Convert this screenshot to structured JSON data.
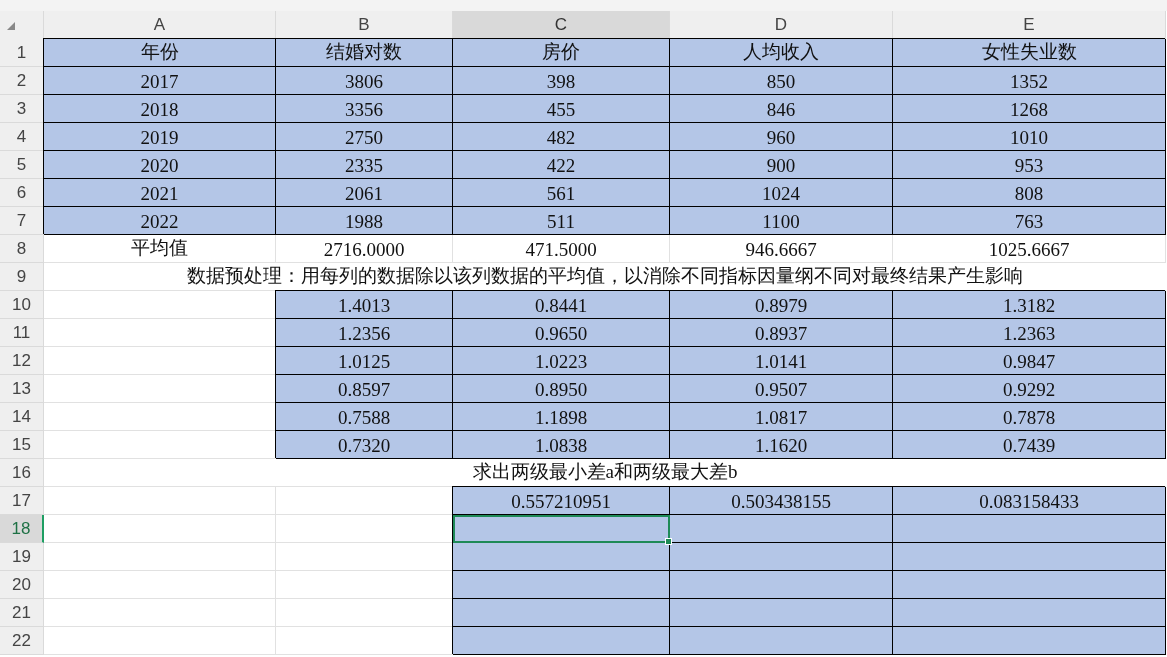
{
  "columns": [
    {
      "label": "A",
      "selected": false
    },
    {
      "label": "B",
      "selected": false
    },
    {
      "label": "C",
      "selected": true
    },
    {
      "label": "D",
      "selected": false
    },
    {
      "label": "E",
      "selected": false
    }
  ],
  "rows": [
    {
      "number": "1",
      "selected": false,
      "kind": "cells",
      "cells": [
        {
          "text": "年份",
          "filled": true,
          "selected": false
        },
        {
          "text": "结婚对数",
          "filled": true,
          "selected": false
        },
        {
          "text": "房价",
          "filled": true,
          "selected": false
        },
        {
          "text": "人均收入",
          "filled": true,
          "selected": false
        },
        {
          "text": "女性失业数",
          "filled": true,
          "selected": false
        }
      ]
    },
    {
      "number": "2",
      "selected": false,
      "kind": "cells",
      "cells": [
        {
          "text": "2017",
          "filled": true,
          "selected": false
        },
        {
          "text": "3806",
          "filled": true,
          "selected": false
        },
        {
          "text": "398",
          "filled": true,
          "selected": false
        },
        {
          "text": "850",
          "filled": true,
          "selected": false
        },
        {
          "text": "1352",
          "filled": true,
          "selected": false
        }
      ]
    },
    {
      "number": "3",
      "selected": false,
      "kind": "cells",
      "cells": [
        {
          "text": "2018",
          "filled": true,
          "selected": false
        },
        {
          "text": "3356",
          "filled": true,
          "selected": false
        },
        {
          "text": "455",
          "filled": true,
          "selected": false
        },
        {
          "text": "846",
          "filled": true,
          "selected": false
        },
        {
          "text": "1268",
          "filled": true,
          "selected": false
        }
      ]
    },
    {
      "number": "4",
      "selected": false,
      "kind": "cells",
      "cells": [
        {
          "text": "2019",
          "filled": true,
          "selected": false
        },
        {
          "text": "2750",
          "filled": true,
          "selected": false
        },
        {
          "text": "482",
          "filled": true,
          "selected": false
        },
        {
          "text": "960",
          "filled": true,
          "selected": false
        },
        {
          "text": "1010",
          "filled": true,
          "selected": false
        }
      ]
    },
    {
      "number": "5",
      "selected": false,
      "kind": "cells",
      "cells": [
        {
          "text": "2020",
          "filled": true,
          "selected": false
        },
        {
          "text": "2335",
          "filled": true,
          "selected": false
        },
        {
          "text": "422",
          "filled": true,
          "selected": false
        },
        {
          "text": "900",
          "filled": true,
          "selected": false
        },
        {
          "text": "953",
          "filled": true,
          "selected": false
        }
      ]
    },
    {
      "number": "6",
      "selected": false,
      "kind": "cells",
      "cells": [
        {
          "text": "2021",
          "filled": true,
          "selected": false
        },
        {
          "text": "2061",
          "filled": true,
          "selected": false
        },
        {
          "text": "561",
          "filled": true,
          "selected": false
        },
        {
          "text": "1024",
          "filled": true,
          "selected": false
        },
        {
          "text": "808",
          "filled": true,
          "selected": false
        }
      ]
    },
    {
      "number": "7",
      "selected": false,
      "kind": "cells",
      "cells": [
        {
          "text": "2022",
          "filled": true,
          "selected": false
        },
        {
          "text": "1988",
          "filled": true,
          "selected": false
        },
        {
          "text": "511",
          "filled": true,
          "selected": false
        },
        {
          "text": "1100",
          "filled": true,
          "selected": false
        },
        {
          "text": "763",
          "filled": true,
          "selected": false
        }
      ]
    },
    {
      "number": "8",
      "selected": false,
      "kind": "cells",
      "cells": [
        {
          "text": "平均值",
          "filled": false,
          "selected": false
        },
        {
          "text": "2716.0000",
          "filled": false,
          "selected": false
        },
        {
          "text": "471.5000",
          "filled": false,
          "selected": false
        },
        {
          "text": "946.6667",
          "filled": false,
          "selected": false
        },
        {
          "text": "1025.6667",
          "filled": false,
          "selected": false
        }
      ]
    },
    {
      "number": "9",
      "selected": false,
      "kind": "note",
      "text": "数据预处理：用每列的数据除以该列数据的平均值，以消除不同指标因量纲不同对最终结果产生影响"
    },
    {
      "number": "10",
      "selected": false,
      "kind": "cells",
      "cells": [
        {
          "filled": false,
          "selected": false
        },
        {
          "text": "1.4013",
          "filled": true,
          "selected": false
        },
        {
          "text": "0.8441",
          "filled": true,
          "selected": false
        },
        {
          "text": "0.8979",
          "filled": true,
          "selected": false
        },
        {
          "text": "1.3182",
          "filled": true,
          "selected": false
        }
      ]
    },
    {
      "number": "11",
      "selected": false,
      "kind": "cells",
      "cells": [
        {
          "filled": false,
          "selected": false
        },
        {
          "text": "1.2356",
          "filled": true,
          "selected": false
        },
        {
          "text": "0.9650",
          "filled": true,
          "selected": false
        },
        {
          "text": "0.8937",
          "filled": true,
          "selected": false
        },
        {
          "text": "1.2363",
          "filled": true,
          "selected": false
        }
      ]
    },
    {
      "number": "12",
      "selected": false,
      "kind": "cells",
      "cells": [
        {
          "filled": false,
          "selected": false
        },
        {
          "text": "1.0125",
          "filled": true,
          "selected": false
        },
        {
          "text": "1.0223",
          "filled": true,
          "selected": false
        },
        {
          "text": "1.0141",
          "filled": true,
          "selected": false
        },
        {
          "text": "0.9847",
          "filled": true,
          "selected": false
        }
      ]
    },
    {
      "number": "13",
      "selected": false,
      "kind": "cells",
      "cells": [
        {
          "filled": false,
          "selected": false
        },
        {
          "text": "0.8597",
          "filled": true,
          "selected": false
        },
        {
          "text": "0.8950",
          "filled": true,
          "selected": false
        },
        {
          "text": "0.9507",
          "filled": true,
          "selected": false
        },
        {
          "text": "0.9292",
          "filled": true,
          "selected": false
        }
      ]
    },
    {
      "number": "14",
      "selected": false,
      "kind": "cells",
      "cells": [
        {
          "filled": false,
          "selected": false
        },
        {
          "text": "0.7588",
          "filled": true,
          "selected": false
        },
        {
          "text": "1.1898",
          "filled": true,
          "selected": false
        },
        {
          "text": "1.0817",
          "filled": true,
          "selected": false
        },
        {
          "text": "0.7878",
          "filled": true,
          "selected": false
        }
      ]
    },
    {
      "number": "15",
      "selected": false,
      "kind": "cells",
      "cells": [
        {
          "filled": false,
          "selected": false
        },
        {
          "text": "0.7320",
          "filled": true,
          "selected": false
        },
        {
          "text": "1.0838",
          "filled": true,
          "selected": false
        },
        {
          "text": "1.1620",
          "filled": true,
          "selected": false
        },
        {
          "text": "0.7439",
          "filled": true,
          "selected": false
        }
      ]
    },
    {
      "number": "16",
      "selected": false,
      "kind": "note",
      "text": "求出两级最小差a和两级最大差b"
    },
    {
      "number": "17",
      "selected": false,
      "kind": "cells",
      "cells": [
        {
          "filled": false,
          "selected": false
        },
        {
          "filled": false,
          "selected": false
        },
        {
          "text": "0.557210951",
          "filled": true,
          "selected": false
        },
        {
          "text": "0.503438155",
          "filled": true,
          "selected": false
        },
        {
          "text": "0.083158433",
          "filled": true,
          "selected": false
        }
      ]
    },
    {
      "number": "18",
      "selected": true,
      "kind": "cells",
      "cells": [
        {
          "filled": false,
          "selected": false
        },
        {
          "filled": false,
          "selected": false
        },
        {
          "filled": true,
          "selected": true
        },
        {
          "filled": true,
          "selected": false
        },
        {
          "filled": true,
          "selected": false
        }
      ]
    },
    {
      "number": "19",
      "selected": false,
      "kind": "cells",
      "cells": [
        {
          "filled": false,
          "selected": false
        },
        {
          "filled": false,
          "selected": false
        },
        {
          "filled": true,
          "selected": false
        },
        {
          "filled": true,
          "selected": false
        },
        {
          "filled": true,
          "selected": false
        }
      ]
    },
    {
      "number": "20",
      "selected": false,
      "kind": "cells",
      "cells": [
        {
          "filled": false,
          "selected": false
        },
        {
          "filled": false,
          "selected": false
        },
        {
          "filled": true,
          "selected": false
        },
        {
          "filled": true,
          "selected": false
        },
        {
          "filled": true,
          "selected": false
        }
      ]
    },
    {
      "number": "21",
      "selected": false,
      "kind": "cells",
      "cells": [
        {
          "filled": false,
          "selected": false
        },
        {
          "filled": false,
          "selected": false
        },
        {
          "filled": true,
          "selected": false
        },
        {
          "filled": true,
          "selected": false
        },
        {
          "filled": true,
          "selected": false
        }
      ]
    },
    {
      "number": "22",
      "selected": false,
      "kind": "cells",
      "cells": [
        {
          "filled": false,
          "selected": false
        },
        {
          "filled": false,
          "selected": false
        },
        {
          "filled": true,
          "selected": false
        },
        {
          "filled": true,
          "selected": false
        },
        {
          "filled": true,
          "selected": false
        }
      ]
    }
  ]
}
